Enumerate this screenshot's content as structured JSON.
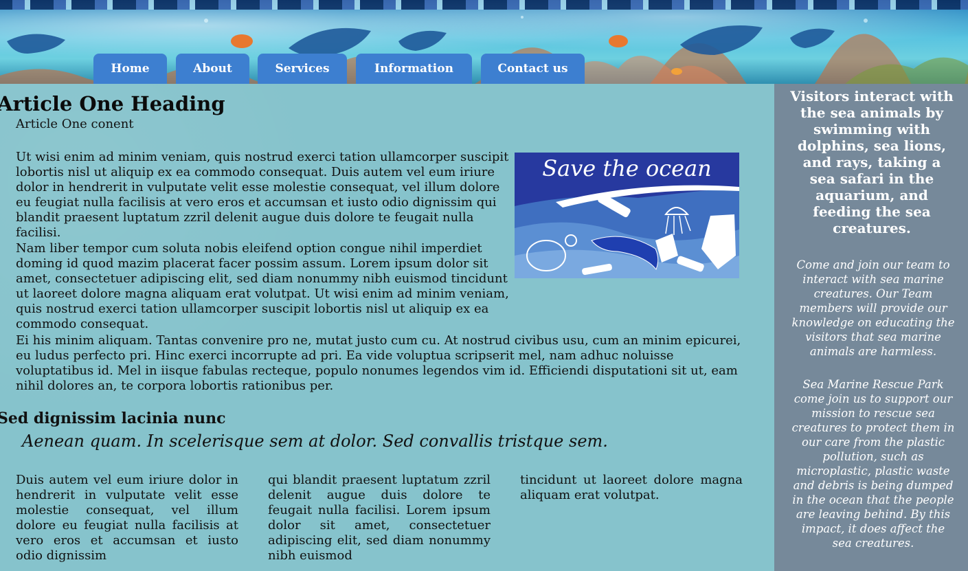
{
  "nav": {
    "items": [
      "Home",
      "About",
      "Services",
      "Information",
      "Contact us"
    ]
  },
  "article": {
    "heading": "Article One Heading",
    "subtitle": "Article One conent",
    "paragraphs": [
      "Ut wisi enim ad minim veniam, quis nostrud exerci tation ullamcorper suscipit lobortis nisl ut aliquip ex ea commodo consequat. Duis autem vel eum iriure dolor in hendrerit in vulputate velit esse molestie consequat, vel illum dolore eu feugiat nulla facilisis at vero eros et accumsan et iusto odio dignissim qui blandit praesent luptatum zzril delenit augue duis dolore te feugait nulla facilisi.",
      "Nam liber tempor cum soluta nobis eleifend option congue nihil imperdiet doming id quod mazim placerat facer possim assum. Lorem ipsum dolor sit amet, consectetuer adipiscing elit, sed diam nonummy nibh euismod tincidunt ut laoreet dolore magna aliquam erat volutpat. Ut wisi enim ad minim veniam, quis nostrud exerci tation ullamcorper suscipit lobortis nisl ut aliquip ex ea commodo consequat.",
      "Ei his minim aliquam. Tantas convenire pro ne, mutat justo cum cu. At nostrud civibus usu, cum an minim epicurei, eu ludus perfecto pri. Hinc exerci incorrupte ad pri. Ea vide voluptua scripserit mel, nam adhuc noluisse voluptatibus id. Mel in iisque fabulas recteque, populo nonumes legendos vim id. Efficiendi disputationi sit ut, eam nihil dolores an, te corpora lobortis rationibus per."
    ],
    "image_caption": "Save the ocean"
  },
  "section": {
    "heading": "Sed dignissim lacinia nunc",
    "quote": "Aenean quam. In scelerisque sem at dolor. Sed convallis tristque sem.",
    "columns": [
      "Duis autem vel eum iriure dolor in hendrerit in vulputate velit esse molestie consequat, vel illum dolore eu feugiat nulla facilisis at vero eros et accumsan et iusto odio dignissim",
      "qui blandit praesent luptatum zzril delenit augue duis dolore te feugait nulla facilisi. Lorem ipsum dolor sit amet, consectetuer adipiscing elit, sed diam nonummy nibh euismod",
      "tincidunt ut laoreet dolore magna aliquam erat volutpat."
    ]
  },
  "aside": {
    "heading": "Visitors interact with the sea animals by swimming with dolphins, sea lions, and rays, taking a sea safari in the aquarium, and feeding the sea creatures.",
    "para1": "Come and join our team to interact with sea marine creatures. Our Team members will provide our knowledge on educating the visitors that sea marine animals are harmless.",
    "para2": "Sea Marine Rescue Park come join us to support our mission to rescue sea creatures to protect them in our care from the plastic pollution, such as microplastic, plastic waste and debris is being dumped in the ocean that the people are leaving behind. By this impact, it does affect the sea creatures."
  },
  "colors": {
    "nav_tab": "#3d7fd0",
    "main_bg": "#86c3cc",
    "aside_bg": "#76899a",
    "image_bg": "#2a3fa3"
  }
}
